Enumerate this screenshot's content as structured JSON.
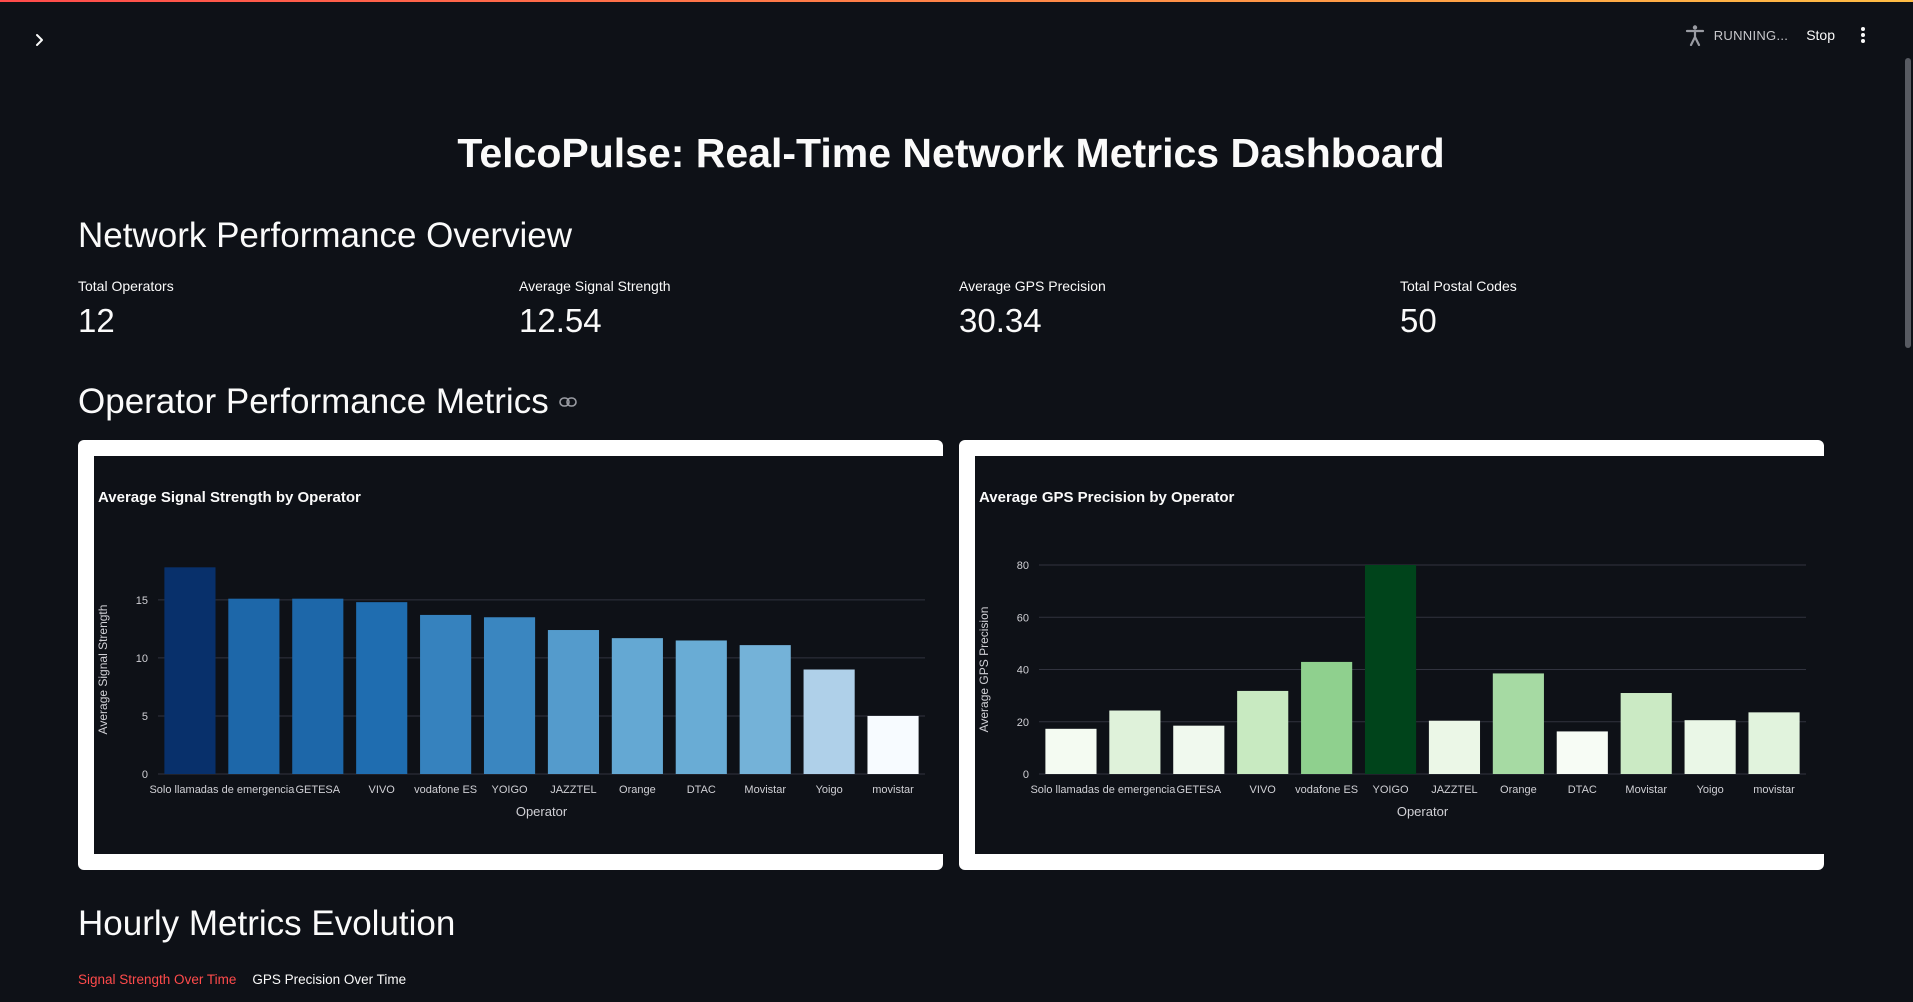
{
  "header": {
    "status_text": "RUNNING...",
    "stop_label": "Stop"
  },
  "page": {
    "title": "TelcoPulse: Real-Time Network Metrics Dashboard"
  },
  "overview": {
    "heading": "Network Performance Overview",
    "metrics": [
      {
        "label": "Total Operators",
        "value": "12"
      },
      {
        "label": "Average Signal Strength",
        "value": "12.54"
      },
      {
        "label": "Average GPS Precision",
        "value": "30.34"
      },
      {
        "label": "Total Postal Codes",
        "value": "50"
      }
    ]
  },
  "operator_section": {
    "heading": "Operator Performance Metrics"
  },
  "hourly_section": {
    "heading": "Hourly Metrics Evolution",
    "tabs": [
      {
        "label": "Signal Strength Over Time",
        "active": true
      },
      {
        "label": "GPS Precision Over Time",
        "active": false
      }
    ]
  },
  "colors": {
    "accent": "#ff4b4b",
    "background": "#0e1117"
  },
  "chart_data": [
    {
      "type": "bar",
      "title": "Average Signal Strength by Operator",
      "xlabel": "Operator",
      "ylabel": "Average Signal Strength",
      "categories": [
        "Solo llamadas de emergencia",
        "GETESA",
        "VIVO",
        "vodafone ES",
        "YOIGO",
        "JAZZTEL",
        "Orange",
        "DTAC",
        "Movistar",
        "Yoigo",
        "movistar"
      ],
      "values": [
        17.8,
        15.1,
        15.1,
        14.8,
        13.7,
        13.5,
        12.4,
        11.7,
        11.5,
        11.1,
        9.0,
        5.0
      ],
      "category_values": {
        "Solo llamadas de emergencia": 17.8,
        "GETESA": 15.1,
        "VIVO": 14.8,
        "vodafone ES": 13.7,
        "YOIGO": 13.5,
        "JAZZTEL": 12.4,
        "Orange": 11.7,
        "DTAC": 11.5,
        "Movistar": 11.1,
        "Yoigo": 9.0,
        "movistar": 5.0
      },
      "yticks": [
        0,
        5,
        10,
        15
      ],
      "ylim": [
        0,
        18
      ],
      "color_scale": "Blues",
      "grid": true
    },
    {
      "type": "bar",
      "title": "Average GPS Precision by Operator",
      "xlabel": "Operator",
      "ylabel": "Average GPS Precision",
      "categories": [
        "Solo llamadas de emergencia",
        "GETESA",
        "VIVO",
        "vodafone ES",
        "YOIGO",
        "JAZZTEL",
        "Orange",
        "DTAC",
        "Movistar",
        "Yoigo",
        "movistar"
      ],
      "values": [
        17.3,
        24.3,
        18.5,
        31.8,
        42.9,
        80.0,
        20.4,
        38.5,
        16.3,
        31.0,
        20.6,
        23.6
      ],
      "yticks": [
        0,
        20,
        40,
        60,
        80
      ],
      "ylim": [
        0,
        80
      ],
      "color_scale": "Greens",
      "grid": true
    }
  ]
}
